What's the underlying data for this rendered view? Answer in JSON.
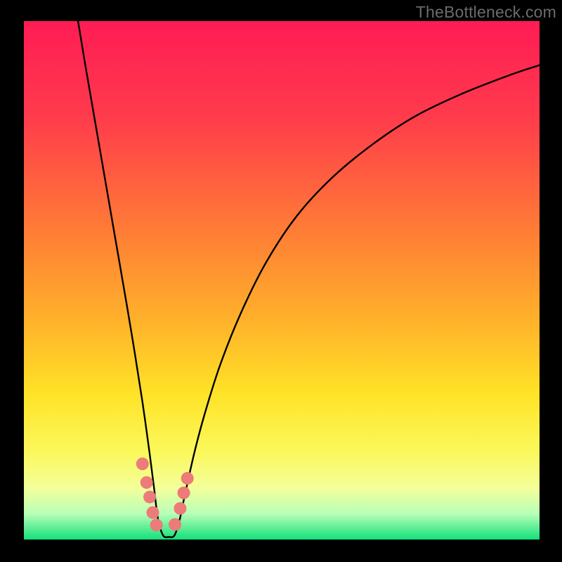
{
  "watermark": "TheBottleneck.com",
  "chart_data": {
    "type": "line",
    "title": "",
    "xlabel": "",
    "ylabel": "",
    "xlim": [
      0,
      100
    ],
    "ylim": [
      0,
      100
    ],
    "grid": false,
    "legend": false,
    "background_gradient": {
      "stops": [
        {
          "pct": 0,
          "color": "#ff1c55"
        },
        {
          "pct": 18,
          "color": "#ff3a4c"
        },
        {
          "pct": 40,
          "color": "#ff7b36"
        },
        {
          "pct": 58,
          "color": "#ffb22a"
        },
        {
          "pct": 72,
          "color": "#ffe327"
        },
        {
          "pct": 83,
          "color": "#fbf85b"
        },
        {
          "pct": 90,
          "color": "#f4ff9a"
        },
        {
          "pct": 95,
          "color": "#b9ffb8"
        },
        {
          "pct": 100,
          "color": "#13e07a"
        }
      ]
    },
    "series": [
      {
        "name": "curve",
        "color": "#000000",
        "x": [
          10.5,
          12,
          14,
          16,
          18,
          20,
          21.5,
          23,
          24.4,
          25.3,
          26.0,
          27.0,
          28.1,
          29.2,
          30.2,
          31.2,
          33,
          35,
          38,
          42,
          47,
          53,
          60,
          68,
          76,
          85,
          94,
          100
        ],
        "y": [
          100,
          91,
          79.5,
          68,
          56.5,
          45,
          36,
          26.5,
          16.5,
          9.5,
          4.0,
          0.8,
          0.5,
          0.8,
          3.8,
          8.5,
          16.5,
          24,
          33.5,
          43.5,
          53.5,
          62.5,
          70,
          76.5,
          81.7,
          86,
          89.5,
          91.5
        ]
      }
    ],
    "markers": {
      "color": "#ec7b79",
      "radius_px": 9,
      "points": [
        {
          "x": 23.0,
          "y": 14.6
        },
        {
          "x": 23.8,
          "y": 11.0
        },
        {
          "x": 24.4,
          "y": 8.2
        },
        {
          "x": 25.0,
          "y": 5.2
        },
        {
          "x": 25.7,
          "y": 2.8
        },
        {
          "x": 29.3,
          "y": 2.9
        },
        {
          "x": 30.3,
          "y": 6.0
        },
        {
          "x": 31.0,
          "y": 9.0
        },
        {
          "x": 31.7,
          "y": 11.8
        }
      ]
    }
  }
}
